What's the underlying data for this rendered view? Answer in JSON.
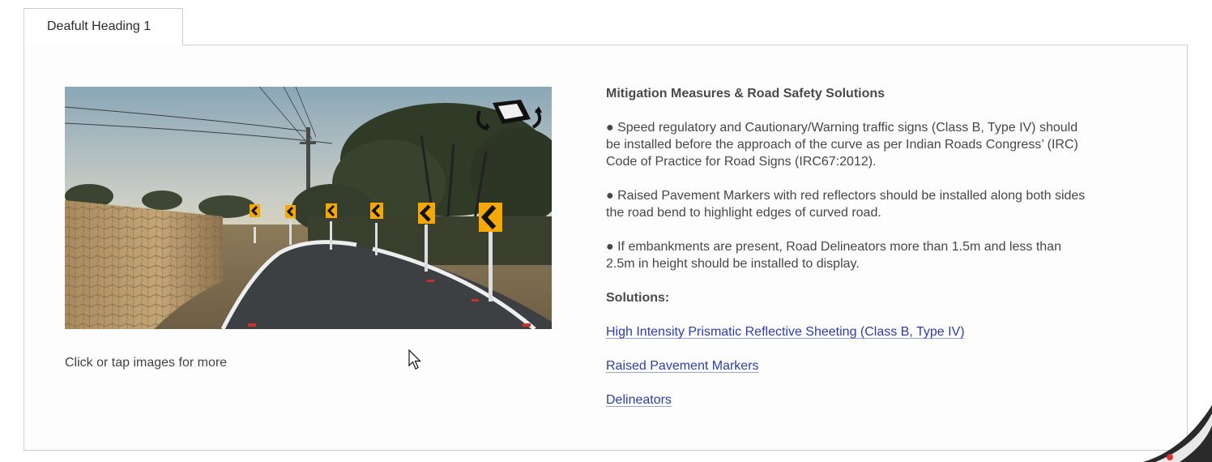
{
  "tabs": [
    {
      "label": "Deafult Heading 1",
      "active": true
    }
  ],
  "media": {
    "caption": "Click or tap images for more",
    "icon": "rotate-view-icon"
  },
  "content": {
    "heading": "Mitigation Measures & Road Safety Solutions",
    "paragraphs": [
      "● Speed regulatory and Cautionary/Warning traffic signs (Class B, Type IV) should be installed before the approach of the curve as per Indian Roads Congress’ (IRC) Code of Practice for Road Signs (IRC67:2012).",
      "● Raised Pavement Markers with red reflectors should be installed along both sides the road bend to highlight edges of curved road.",
      "● If embankments are present, Road Delineators more than 1.5m and less than 2.5m in height should be installed to display."
    ],
    "solutions_heading": "Solutions:",
    "solutions": [
      "High Intensity Prismatic Reflective Sheeting (Class B, Type IV)",
      "Raised Pavement Markers",
      "Delineators"
    ]
  },
  "colors": {
    "link": "#2c3fa8",
    "sign_yellow": "#f5a800",
    "border": "#cfcfcf"
  }
}
